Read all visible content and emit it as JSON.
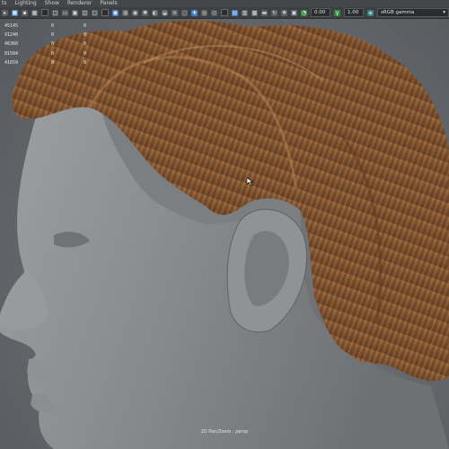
{
  "menubar": {
    "items": [
      {
        "label": "ts"
      },
      {
        "label": "Lighting"
      },
      {
        "label": "Show"
      },
      {
        "label": "Renderer"
      },
      {
        "label": "Panels"
      }
    ]
  },
  "toolbar": {
    "exposure_value": "0.00",
    "gamma_value": "1.00",
    "color_space": "sRGB gamma"
  },
  "hud": {
    "rows": [
      {
        "value": "45145",
        "col2": "0",
        "col3": "0"
      },
      {
        "value": "91240",
        "col2": "0",
        "col3": "0"
      },
      {
        "value": "46360",
        "col2": "0",
        "col3": "0"
      },
      {
        "value": "81584",
        "col2": "0",
        "col3": "0"
      },
      {
        "value": "41659",
        "col2": "0",
        "col3": "0"
      }
    ]
  },
  "viewport": {
    "camera_label": "2D Pan/Zoom : persp"
  },
  "colors": {
    "viewport_bg": "#64686c",
    "head_clay": "#8a8e91",
    "hair_brown": "#8a5a33",
    "toolbar_bg": "#3d3f42",
    "accent_blue": "#3c7ec8",
    "accent_green": "#2f8d3a"
  }
}
